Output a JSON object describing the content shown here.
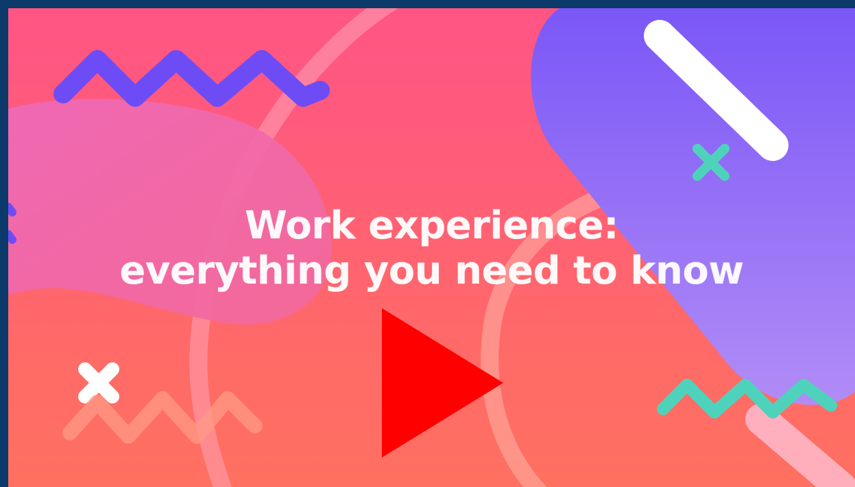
{
  "video": {
    "title_line1": "Work experience:",
    "title_line2": "everything you need to know",
    "play_button": "play-icon"
  },
  "colors": {
    "frame": "#0b3a6b",
    "background_top": "#ff5585",
    "background_bottom": "#ff7060",
    "purple_zigzag": "#6e4cf5",
    "purple_capsule": "#8a6af5",
    "pink_blob": "#f06aa8",
    "teal_accent": "#4fd2bb",
    "play_button": "#ff0000",
    "title_text": "#ffffff"
  }
}
